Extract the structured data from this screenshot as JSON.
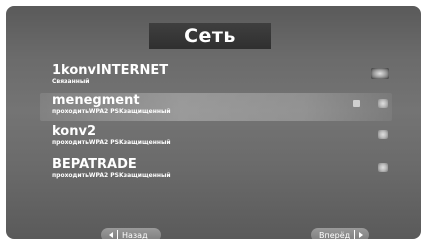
{
  "header": {
    "title": "Сеть"
  },
  "networks": [
    {
      "name": "1konvINTERNET",
      "status": "Связанный",
      "selected": false,
      "icon": "connected-icon"
    },
    {
      "name": "menegment",
      "status": "проходитьWPA2 PSKзащищенный",
      "selected": true,
      "icon": "wifi-signal-icon",
      "locked": true
    },
    {
      "name": "konv2",
      "status": "проходитьWPA2 PSKзащищенный",
      "selected": false,
      "icon": "wifi-signal-icon"
    },
    {
      "name": "BEPATRADE",
      "status": "проходитьWPA2 PSKзащищенный",
      "selected": false,
      "icon": "wifi-signal-icon"
    }
  ],
  "footer": {
    "back_label": "Назад",
    "forward_label": "Вперёд"
  },
  "colors": {
    "background": "#6b6b6b",
    "title_box": "#333333",
    "text": "#ffffff",
    "button": "#8a8a8a"
  }
}
